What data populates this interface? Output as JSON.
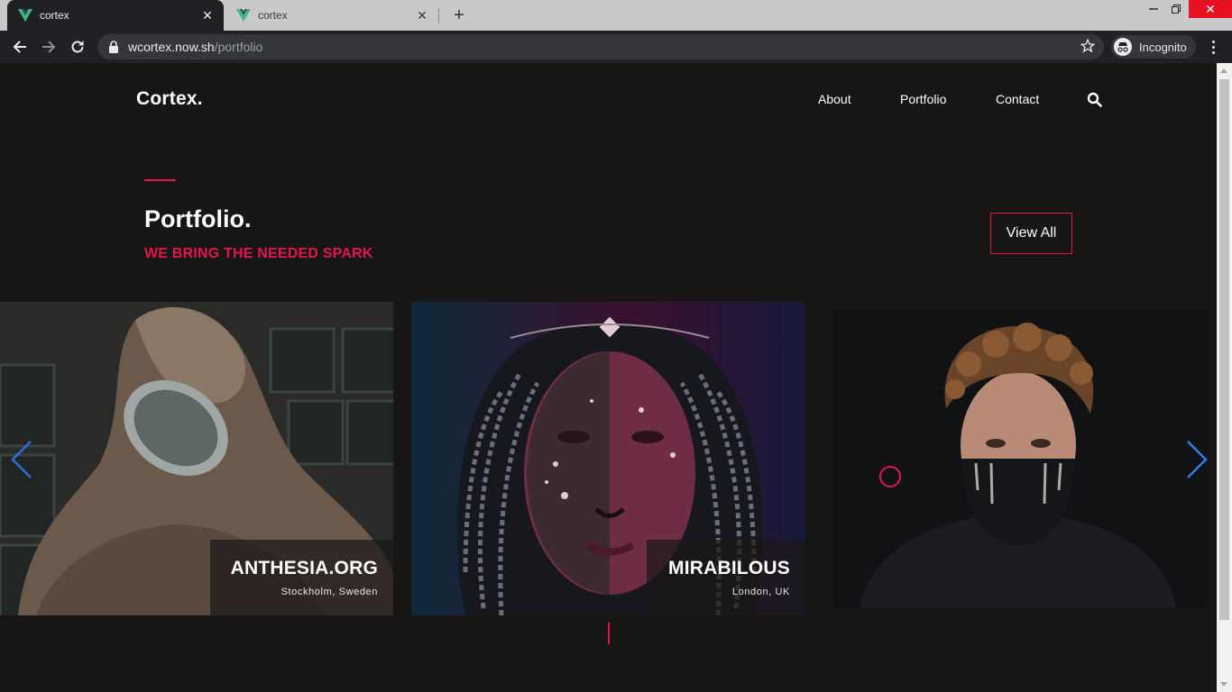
{
  "browser": {
    "tabs": [
      {
        "title": "cortex",
        "active": true
      },
      {
        "title": "cortex",
        "active": false
      }
    ],
    "url_host": "wcortex.now.sh",
    "url_path": "/portfolio",
    "profile_label": "Incognito",
    "favicon_color": "#41b883"
  },
  "site": {
    "logo": "Cortex.",
    "nav": [
      "About",
      "Portfolio",
      "Contact"
    ],
    "accent_color": "#e0184d"
  },
  "section": {
    "title": "Portfolio.",
    "subtitle": "WE BRING THE NEEDED SPARK",
    "view_all_label": "View All"
  },
  "portfolio": [
    {
      "name": "ANTHESIA.ORG",
      "location": "Stockholm, Sweden",
      "image": "hooded person holding a mirror"
    },
    {
      "name": "MIRABILOUS",
      "location": "London, UK",
      "image": "woman with braids in pink light"
    },
    {
      "name": "",
      "location": "",
      "image": "man with black face paint"
    }
  ],
  "icons": {
    "back": "back-arrow-icon",
    "forward": "forward-arrow-icon",
    "reload": "reload-icon",
    "lock": "lock-icon",
    "bookmark": "star-icon",
    "search": "search-icon",
    "prev": "chevron-left-icon",
    "next": "chevron-right-icon"
  }
}
